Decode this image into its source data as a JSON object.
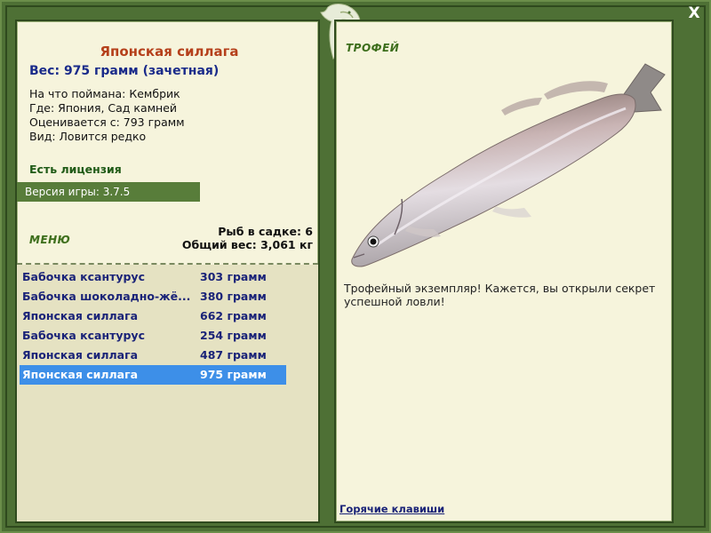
{
  "fish": {
    "name": "Японская силлага",
    "weight_line": "Вес: 975 грамм (зачетная)",
    "bait": "На что поймана: Кембрик",
    "location": "Где: Япония, Сад камней",
    "valued_from": "Оценивается с: 793 грамм",
    "kind": "Вид: Ловится редко"
  },
  "license_text": "Есть лицензия",
  "version_text": "Версия игры: 3.7.5",
  "menu_label": "МЕНЮ",
  "stats": {
    "fish_in_keepnet": "Рыб в садке: 6",
    "total_weight": "Общий вес: 3,061 кг"
  },
  "catches": [
    {
      "name": "Бабочка ксантурус",
      "weight": "303 грамм",
      "selected": false
    },
    {
      "name": "Бабочка шоколадно-жё...",
      "weight": "380 грамм",
      "selected": false
    },
    {
      "name": "Японская силлага",
      "weight": "662 грамм",
      "selected": false
    },
    {
      "name": "Бабочка ксантурус",
      "weight": "254 грамм",
      "selected": false
    },
    {
      "name": "Японская силлага",
      "weight": "487 грамм",
      "selected": false
    },
    {
      "name": "Японская силлага",
      "weight": "975 грамм",
      "selected": true
    }
  ],
  "trophy": {
    "label": "ТРОФЕЙ",
    "text": "Трофейный экземпляр! Кажется, вы открыли секрет успешной ловли!"
  },
  "hotkeys_label": "Горячие клавиши",
  "close_label": "X",
  "colors": {
    "frame": "#4e7035",
    "panel": "#f6f4dc",
    "title": "#b5401b",
    "weight": "#1a2b8a",
    "selected_row": "#3d8fe8"
  }
}
